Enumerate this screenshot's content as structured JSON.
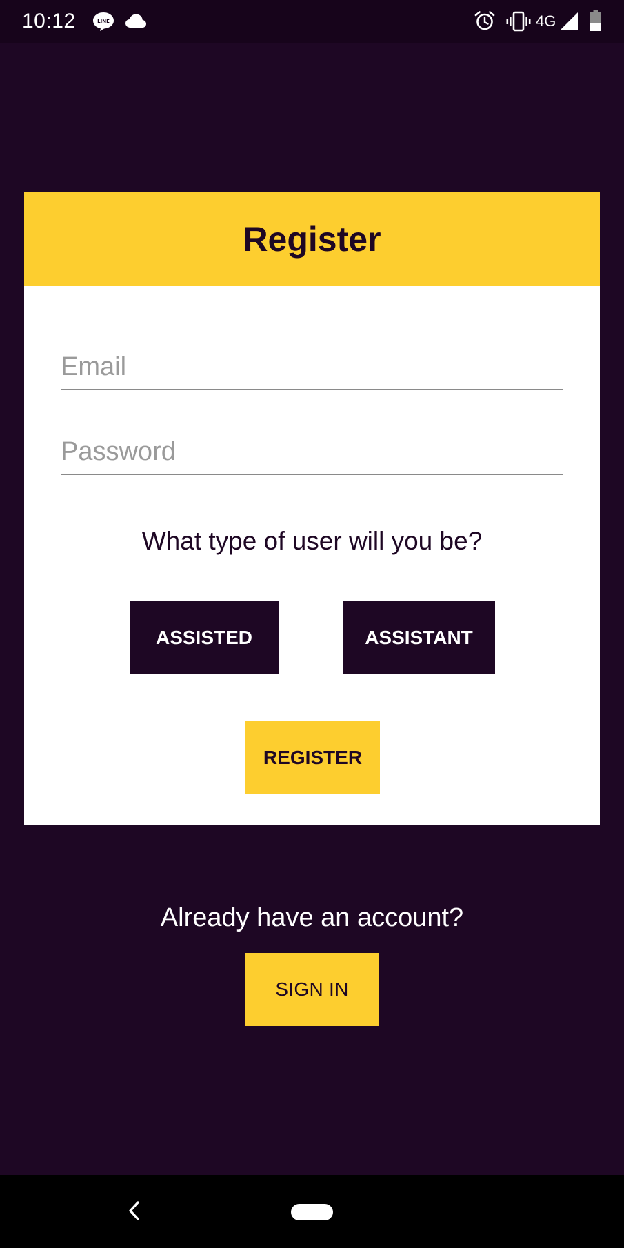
{
  "status_bar": {
    "time": "10:12",
    "network": "4G",
    "icons": [
      "line-icon",
      "cloud-icon",
      "alarm-icon",
      "vibrate-icon",
      "signal-icon",
      "battery-icon"
    ]
  },
  "register_card": {
    "title": "Register",
    "email": {
      "placeholder": "Email",
      "value": ""
    },
    "password": {
      "placeholder": "Password",
      "value": ""
    },
    "user_type_question": "What type of user will you be?",
    "user_type_options": [
      "ASSISTED",
      "ASSISTANT"
    ],
    "register_label": "REGISTER"
  },
  "sign_in": {
    "prompt": "Already have an account?",
    "button_label": "SIGN IN"
  },
  "nav_bar": {
    "icons": [
      "back-icon",
      "home-button"
    ]
  },
  "colors": {
    "background": "#1e0724",
    "accent": "#fdce2f",
    "card": "#ffffff"
  }
}
